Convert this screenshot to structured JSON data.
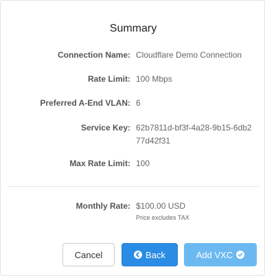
{
  "summary": {
    "title": "Summary",
    "fields": [
      {
        "label": "Connection Name:",
        "value": "Cloudflare Demo Connection"
      },
      {
        "label": "Rate Limit:",
        "value": "100 Mbps"
      },
      {
        "label": "Preferred A-End VLAN:",
        "value": "6"
      },
      {
        "label": "Service Key:",
        "value": "62b7811d-bf3f-4a28-9b15-6db277d42f31"
      },
      {
        "label": "Max Rate Limit:",
        "value": "100"
      }
    ],
    "monthly": {
      "label": "Monthly Rate:",
      "value": "$100.00 USD",
      "note": "Price excludes TAX"
    }
  },
  "buttons": {
    "cancel": "Cancel",
    "back": "Back",
    "add": "Add VXC"
  },
  "icons": {
    "back": "arrow-left-circle-icon",
    "add": "check-circle-icon"
  },
  "colors": {
    "primary": "#2a8ce4",
    "primary_light": "#6cb9f2"
  }
}
